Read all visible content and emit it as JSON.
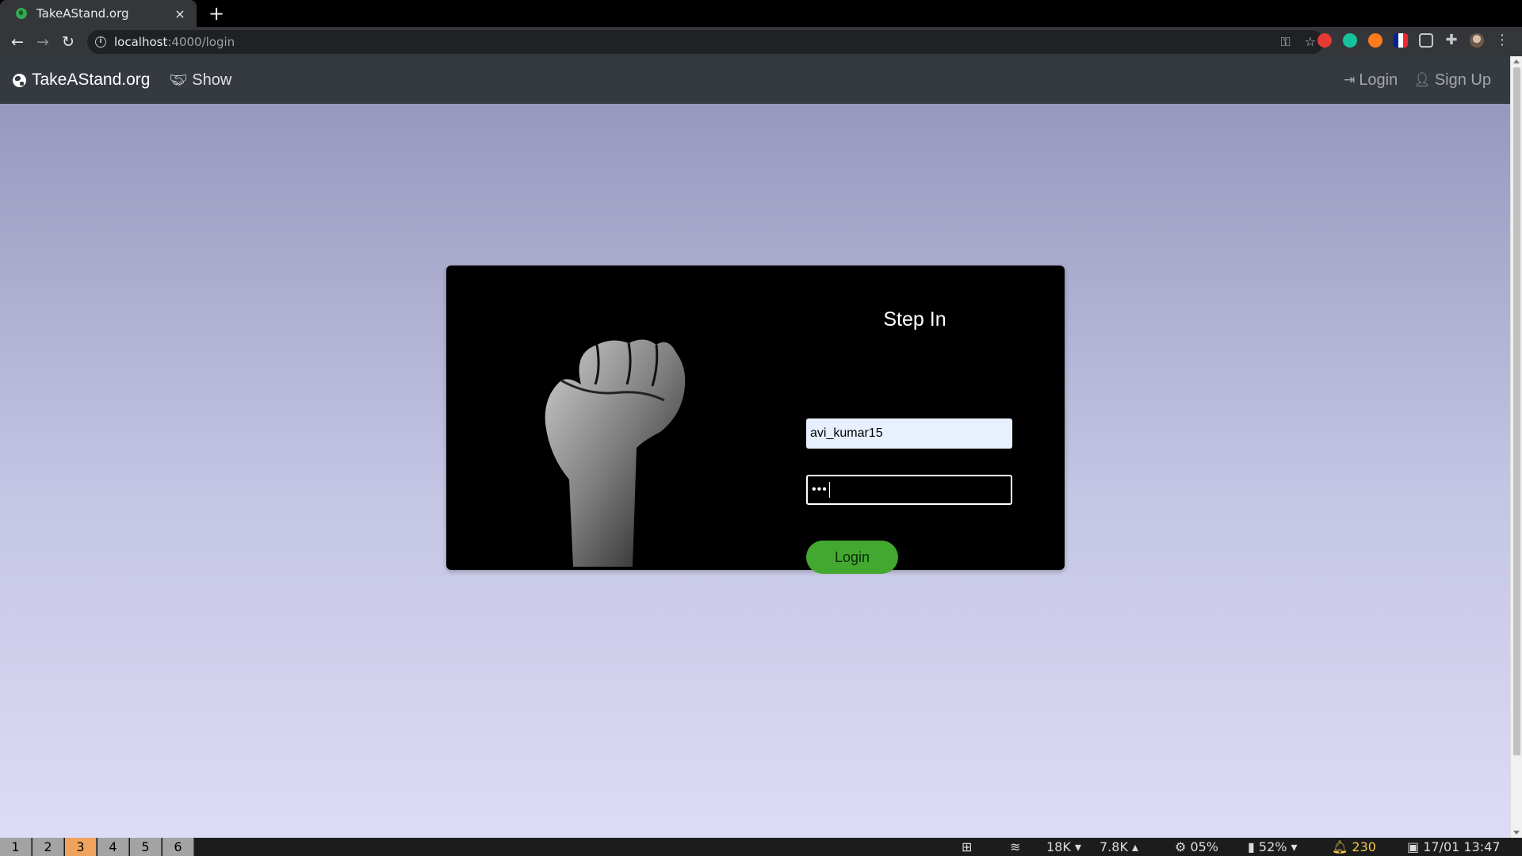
{
  "browser": {
    "tab_title": "TakeAStand.org",
    "tab_close": "×",
    "new_tab": "+",
    "url_host": "localhost",
    "url_path": ":4000/login",
    "nav": {
      "back": "←",
      "forward": "→",
      "reload": "↻"
    },
    "omnibox_icons": {
      "key": "⚿",
      "star": "☆"
    },
    "extensions": [
      "red-ext-icon",
      "grammarly-icon",
      "orange-ext-icon",
      "flag-ext-icon",
      "tv-ext-icon",
      "puzzle-icon",
      "profile-avatar",
      "menu-icon"
    ]
  },
  "site_nav": {
    "brand": "TakeAStand.org",
    "show": "Show",
    "login": "Login",
    "signup": "Sign Up"
  },
  "login_card": {
    "title": "Step In",
    "username_value": "avi_kumar15",
    "password_masked": "•••",
    "login_button": "Login"
  },
  "statusbar": {
    "workspaces": [
      "1",
      "2",
      "3",
      "4",
      "5",
      "6"
    ],
    "active_workspace": "3",
    "net_down": "18K",
    "net_up": "7.8K",
    "cpu": "05%",
    "battery": "52%",
    "notifications": "230",
    "datetime": "17/01 13:47"
  },
  "colors": {
    "navbar_bg": "#343a40",
    "login_button": "#43a830",
    "active_workspace": "#f0a35c"
  }
}
